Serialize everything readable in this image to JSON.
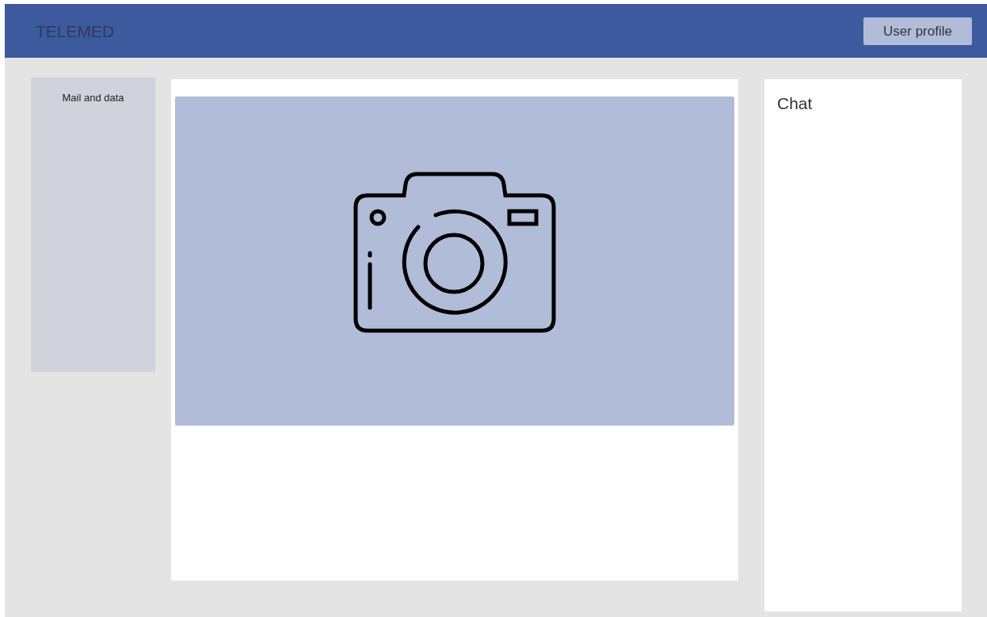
{
  "header": {
    "logo": "TELEMED",
    "profile_button": "User profile"
  },
  "sidebar": {
    "title": "Mail and data"
  },
  "video": {
    "kind": "camera-placeholder"
  },
  "chat": {
    "title": "Chat"
  }
}
